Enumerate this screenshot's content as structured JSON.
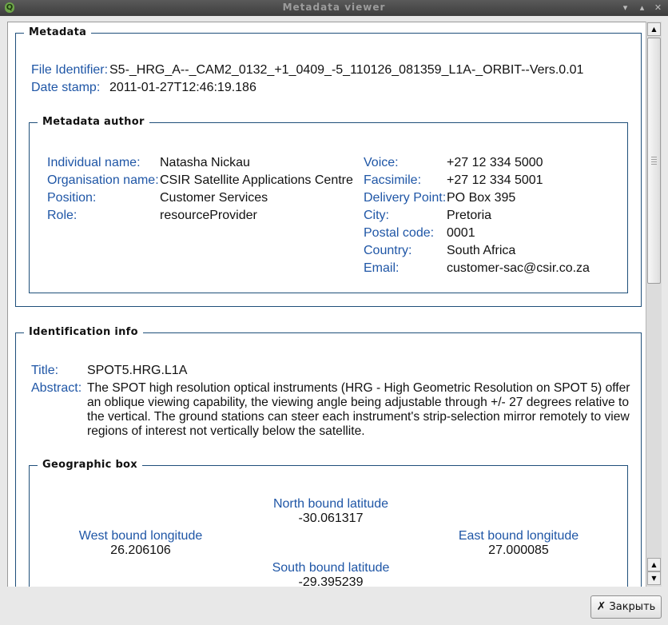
{
  "window": {
    "title": "Metadata viewer",
    "app_icon": "Q",
    "minimize_glyph": "▾",
    "maximize_glyph": "▴",
    "close_glyph": "✕"
  },
  "metadata": {
    "legend": "Metadata",
    "file_identifier_label": "File Identifier:",
    "file_identifier": "S5-_HRG_A--_CAM2_0132_+1_0409_-5_110126_081359_L1A-_ORBIT--Vers.0.01",
    "date_stamp_label": "Date stamp:",
    "date_stamp": "2011-01-27T12:46:19.186"
  },
  "author": {
    "legend": "Metadata author",
    "individual_name_label": "Individual name:",
    "individual_name": "Natasha Nickau",
    "organisation_label": "Organisation name:",
    "organisation": "CSIR Satellite Applications Centre",
    "position_label": "Position:",
    "position": "Customer Services",
    "role_label": "Role:",
    "role": "resourceProvider",
    "voice_label": "Voice:",
    "voice": "+27 12 334 5000",
    "facsimile_label": "Facsimile:",
    "facsimile": "+27 12 334 5001",
    "delivery_label": "Delivery Point:",
    "delivery": "PO Box 395",
    "city_label": "City:",
    "city": "Pretoria",
    "postal_label": "Postal code:",
    "postal": "0001",
    "country_label": "Country:",
    "country": "South Africa",
    "email_label": "Email:",
    "email": "customer-sac@csir.co.za"
  },
  "identification": {
    "legend": "Identification info",
    "title_label": "Title:",
    "title": "SPOT5.HRG.L1A",
    "abstract_label": "Abstract:",
    "abstract": "The SPOT high resolution optical instruments (HRG - High Geometric Resolution on SPOT 5) offer an oblique viewing capability, the viewing angle being adjustable through +/- 27 degrees relative to the vertical. The ground stations can steer each instrument's strip-selection mirror remotely to view regions of interest not vertically below the satellite."
  },
  "geobox": {
    "legend": "Geographic box",
    "north_label": "North bound latitude",
    "north": "-30.061317",
    "west_label": "West bound longitude",
    "west": "26.206106",
    "east_label": "East bound longitude",
    "east": "27.000085",
    "south_label": "South bound latitude",
    "south": "-29.395239"
  },
  "scrollbar": {
    "up_glyph": "▲",
    "down_glyph": "▼"
  },
  "buttons": {
    "close_icon": "✗",
    "close_label": "Закрыть"
  }
}
